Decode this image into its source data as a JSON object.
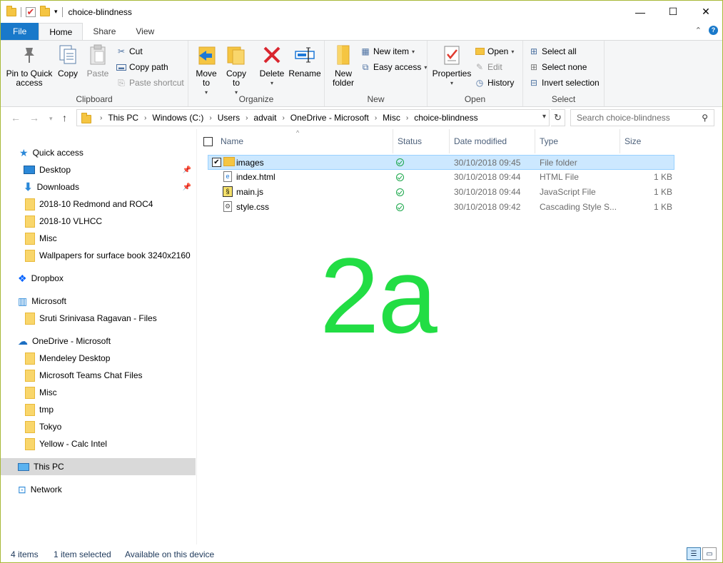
{
  "window": {
    "title": "choice-blindness"
  },
  "tabs": {
    "file": "File",
    "home": "Home",
    "share": "Share",
    "view": "View"
  },
  "ribbon": {
    "clipboard": {
      "pin": "Pin to Quick access",
      "copy": "Copy",
      "paste": "Paste",
      "cut": "Cut",
      "copy_path": "Copy path",
      "paste_shortcut": "Paste shortcut",
      "title": "Clipboard"
    },
    "organize": {
      "move_to": "Move to",
      "copy_to": "Copy to",
      "delete": "Delete",
      "rename": "Rename",
      "title": "Organize"
    },
    "new": {
      "new_folder": "New folder",
      "new_item": "New item",
      "easy_access": "Easy access",
      "title": "New"
    },
    "open": {
      "properties": "Properties",
      "open": "Open",
      "edit": "Edit",
      "history": "History",
      "title": "Open"
    },
    "select": {
      "select_all": "Select all",
      "select_none": "Select none",
      "invert": "Invert selection",
      "title": "Select"
    }
  },
  "address": {
    "crumbs": [
      "This PC",
      "Windows (C:)",
      "Users",
      "advait",
      "OneDrive - Microsoft",
      "Misc",
      "choice-blindness"
    ],
    "search_placeholder": "Search choice-blindness"
  },
  "nav": {
    "quick_access": "Quick access",
    "desktop": "Desktop",
    "downloads": "Downloads",
    "f1": "2018-10 Redmond and ROC4",
    "f2": "2018-10 VLHCC",
    "f3": "Misc",
    "f4": "Wallpapers for surface book 3240x2160",
    "dropbox": "Dropbox",
    "microsoft": "Microsoft",
    "sruti": "Sruti Srinivasa Ragavan - Files",
    "onedrive": "OneDrive - Microsoft",
    "o1": "Mendeley Desktop",
    "o2": "Microsoft Teams Chat Files",
    "o3": "Misc",
    "o4": "tmp",
    "o5": "Tokyo",
    "o6": "Yellow - Calc Intel",
    "this_pc": "This PC",
    "network": "Network"
  },
  "columns": {
    "name": "Name",
    "status": "Status",
    "date": "Date modified",
    "type": "Type",
    "size": "Size"
  },
  "files": [
    {
      "name": "images",
      "date": "30/10/2018 09:45",
      "type": "File folder",
      "size": ""
    },
    {
      "name": "index.html",
      "date": "30/10/2018 09:44",
      "type": "HTML File",
      "size": "1 KB"
    },
    {
      "name": "main.js",
      "date": "30/10/2018 09:44",
      "type": "JavaScript File",
      "size": "1 KB"
    },
    {
      "name": "style.css",
      "date": "30/10/2018 09:42",
      "type": "Cascading Style S...",
      "size": "1 KB"
    }
  ],
  "overlay": "2a",
  "status": {
    "count": "4 items",
    "selected": "1 item selected",
    "available": "Available on this device"
  },
  "colors": {
    "accent": "#1979ca",
    "overlay": "#22dd44",
    "selection": "#cce8ff"
  }
}
